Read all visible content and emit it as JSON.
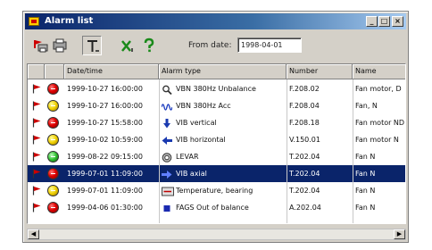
{
  "window": {
    "title": "Alarm list"
  },
  "toolbar": {
    "from_label": "From date:",
    "from_value": "1998-04-01",
    "tools": [
      {
        "name": "print-icon",
        "pressed": false
      },
      {
        "name": "preview-icon",
        "pressed": false
      },
      {
        "name": "text-tool-icon",
        "pressed": true
      },
      {
        "name": "acknowledge-icon",
        "pressed": false
      },
      {
        "name": "help-icon",
        "pressed": false
      }
    ]
  },
  "columns": [
    "",
    "",
    "Date/time",
    "Alarm type",
    "Number",
    "Name"
  ],
  "rows": [
    {
      "status": "red",
      "datetime": "1999-10-27 16:00:00",
      "icon": "magnifier-icon",
      "type": "VBN 380Hz  Unbalance",
      "number": "F.208.02",
      "name": "Fan motor, D"
    },
    {
      "status": "yellow",
      "datetime": "1999-10-27 16:00:00",
      "icon": "waveform-icon",
      "type": "VBN 380Hz  Acc",
      "number": "F.208.04",
      "name": "Fan, N"
    },
    {
      "status": "red",
      "datetime": "1999-10-27 15:58:00",
      "icon": "arrow-down-icon",
      "type": "VIB vertical",
      "number": "F.208.18",
      "name": "Fan motor ND"
    },
    {
      "status": "yellow",
      "datetime": "1999-10-02 10:59:00",
      "icon": "arrow-left-icon",
      "type": "VIB horizontal",
      "number": "V.150.01",
      "name": "Fan motor N"
    },
    {
      "status": "green",
      "datetime": "1999-08-22 09:15:00",
      "icon": "gauge-icon",
      "type": "LEVAR",
      "number": "T.202.04",
      "name": "Fan N"
    },
    {
      "status": "red",
      "datetime": "1999-07-01 11:09:00",
      "icon": "arrow-right-icon",
      "type": "VIB axial",
      "number": "T.202.04",
      "name": "Fan N",
      "selected": true
    },
    {
      "status": "yellow",
      "datetime": "1999-07-01 11:09:00",
      "icon": "thermometer-icon",
      "type": "Temperature, bearing",
      "number": "T.202.04",
      "name": "Fan N"
    },
    {
      "status": "red",
      "datetime": "1999-04-06 01:30:00",
      "icon": "square-icon",
      "type": "FAGS Out of balance",
      "number": "A.202.04",
      "name": "Fan N"
    }
  ],
  "colors": {
    "selection": "#0a246a",
    "flag": "#cc0000"
  }
}
